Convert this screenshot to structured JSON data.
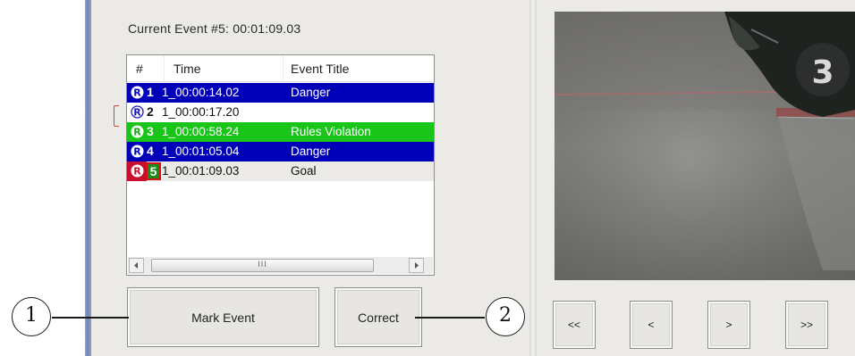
{
  "current_event": "Current Event #5: 00:01:09.03",
  "list": {
    "headers": [
      "#",
      "Time",
      "Event Title"
    ],
    "rows": [
      {
        "icon": "registered-icon",
        "num": "1",
        "time": "1_00:00:14.02",
        "title": "Danger",
        "style": "blue"
      },
      {
        "icon": "registered-icon",
        "num": "2",
        "time": "1_00:00:17.20",
        "title": "",
        "style": "white"
      },
      {
        "icon": "registered-icon",
        "num": "3",
        "time": "1_00:00:58.24",
        "title": "Rules Violation",
        "style": "green"
      },
      {
        "icon": "registered-icon",
        "num": "4",
        "time": "1_00:01:05.04",
        "title": "Danger",
        "style": "blue"
      },
      {
        "icon": "registered-icon",
        "num": "5",
        "time": "1_00:01:09.03",
        "title": "Goal",
        "style": "current"
      }
    ],
    "scroll_grip": "III"
  },
  "buttons": {
    "mark_event": "Mark Event",
    "correct": "Correct",
    "nav": [
      "<<",
      "<",
      ">",
      ">>"
    ]
  },
  "callouts": [
    "1",
    "2"
  ],
  "colors": {
    "danger": "#0000b8",
    "rules_violation": "#19c519",
    "current": "#c8102e"
  }
}
